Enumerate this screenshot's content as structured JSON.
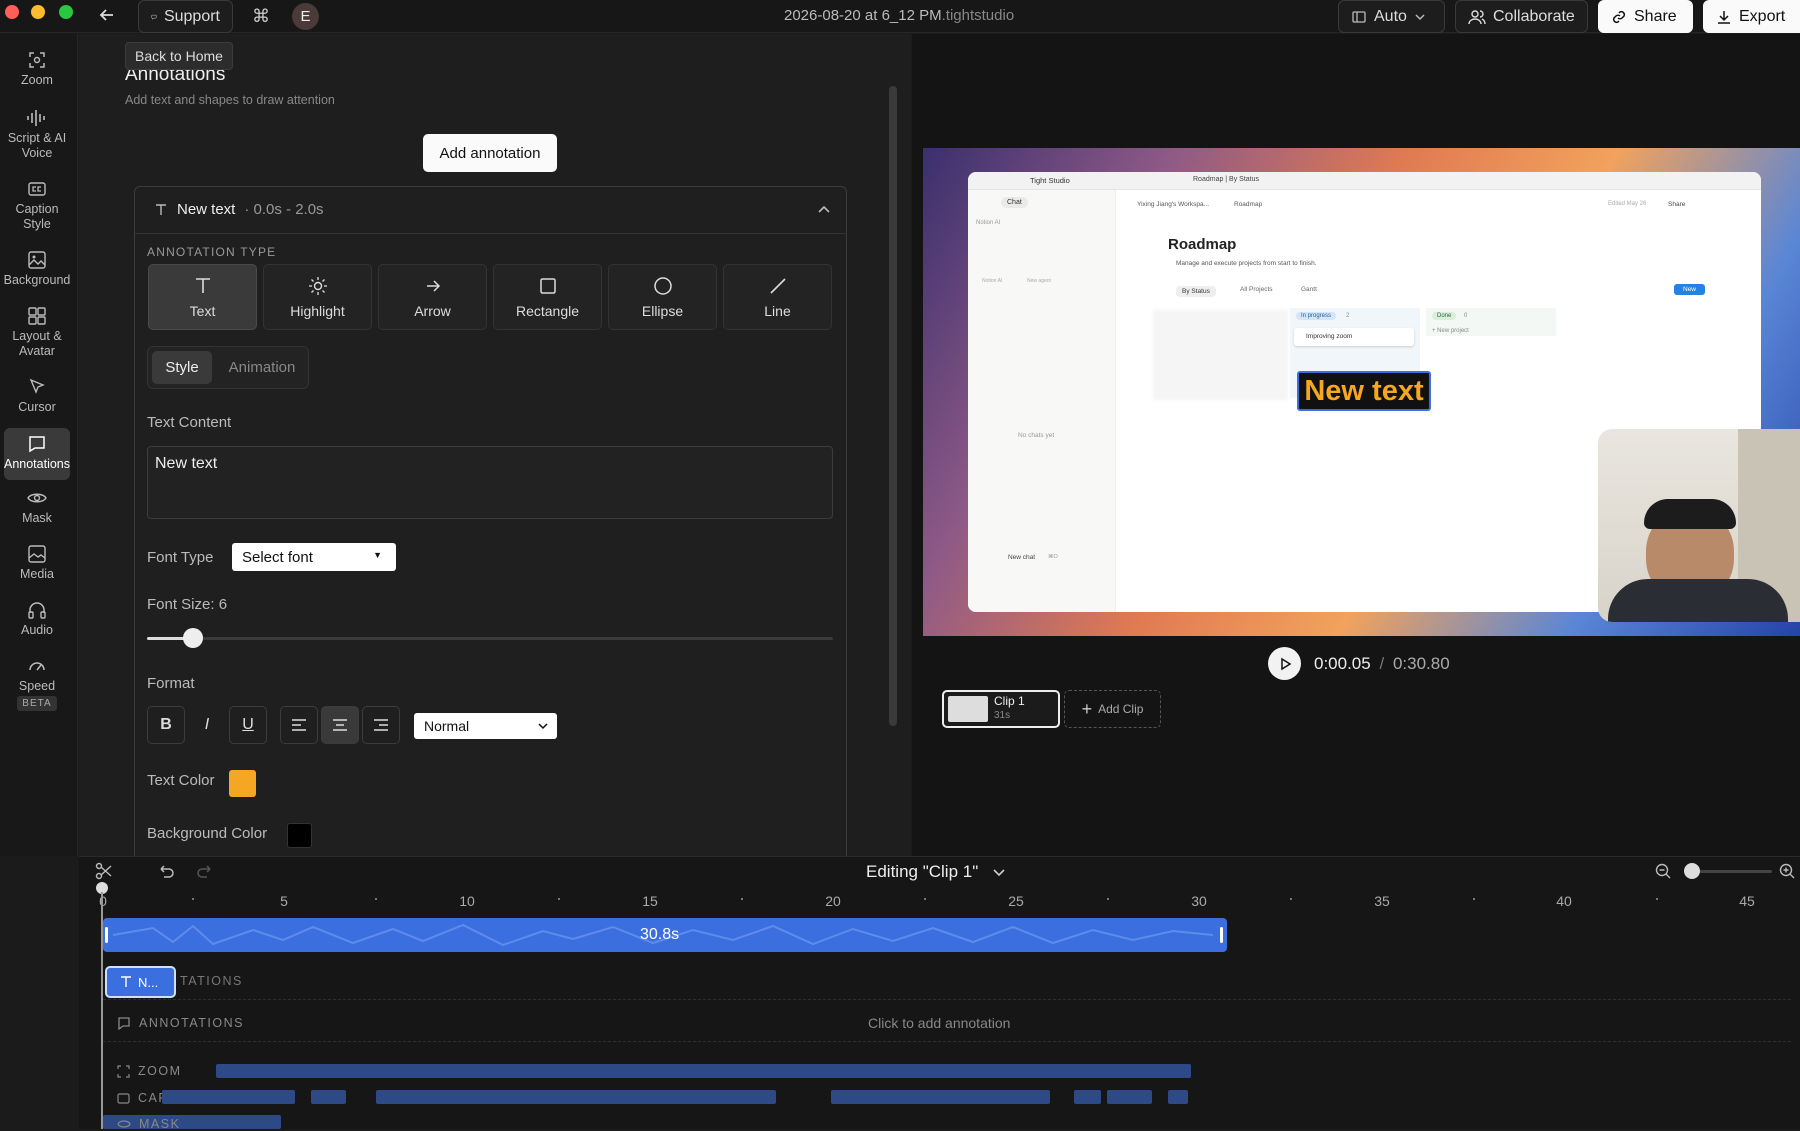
{
  "window": {
    "title_main": "2026-08-20 at 6_12 PM",
    "title_ext": ".tightstudio",
    "avatar_letter": "E"
  },
  "toolbar": {
    "support": "Support",
    "auto": "Auto",
    "collaborate": "Collaborate",
    "share": "Share",
    "export": "Export"
  },
  "tooltip": "Back to Home",
  "rail": [
    {
      "label": "Zoom",
      "icon": "zoom-icon"
    },
    {
      "label": "Script & AI Voice",
      "icon": "waveform-icon"
    },
    {
      "label": "Caption Style",
      "icon": "caption-icon"
    },
    {
      "label": "Background",
      "icon": "image-icon"
    },
    {
      "label": "Layout & Avatar",
      "icon": "grid-icon"
    },
    {
      "label": "Cursor",
      "icon": "cursor-icon"
    },
    {
      "label": "Annotations",
      "icon": "annotation-icon"
    },
    {
      "label": "Mask",
      "icon": "eye-icon"
    },
    {
      "label": "Media",
      "icon": "media-icon"
    },
    {
      "label": "Audio",
      "icon": "headphones-icon"
    },
    {
      "label": "Speed",
      "icon": "speedometer-icon",
      "badge": "BETA"
    }
  ],
  "panel": {
    "title": "Annotations",
    "subtitle": "Add text and shapes to draw attention",
    "add_button": "Add annotation",
    "item": {
      "name": "New text",
      "range": "· 0.0s - 2.0s"
    },
    "type_label": "ANNOTATION TYPE",
    "types": [
      "Text",
      "Highlight",
      "Arrow",
      "Rectangle",
      "Ellipse",
      "Line"
    ],
    "tabs": [
      "Style",
      "Animation"
    ],
    "text_content_label": "Text Content",
    "text_content": "New text",
    "font_type_label": "Font Type",
    "font_select": "Select font",
    "font_size_label": "Font Size: 6",
    "font_size_value": 6,
    "format_label": "Format",
    "format_buttons": [
      "B",
      "I",
      "U"
    ],
    "weight_select": "Normal",
    "text_color_label": "Text Color",
    "text_color": "#f5a623",
    "bg_color_label": "Background Color",
    "bg_color": "#000000"
  },
  "preview": {
    "overlay_text": "New text",
    "app": {
      "brand": "Tight Studio",
      "tab": "Roadmap | By Status",
      "breadcrumb1": "Yixing Jiang's Workspa...",
      "breadcrumb2": "Roadmap",
      "edited": "Edited May 26",
      "share": "Share",
      "chat": "Chat",
      "notion_ai": "Notion AI",
      "new_agent": "New agent",
      "notion_ai_small": "Notion AI",
      "no_chats": "No chats yet",
      "new_chat": "New chat",
      "new_chat_kbd": "⌘O",
      "heading": "Roadmap",
      "desc": "Manage and execute projects from start to finish.",
      "views": [
        "By Status",
        "All Projects",
        "Gantt"
      ],
      "new_btn": "New",
      "cols": [
        {
          "name": "In progress",
          "count": "2"
        },
        {
          "name": "Done",
          "count": "0"
        }
      ],
      "card1": "Improving zoom",
      "new_project": "+ New project"
    },
    "time_current": "0:00.05",
    "time_sep": "/",
    "time_total": "0:30.80",
    "clip": {
      "name": "Clip 1",
      "dur": "31s"
    },
    "add_clip": "Add Clip"
  },
  "timeline": {
    "editing": "Editing \"Clip 1\"",
    "ticks": [
      "0",
      "5",
      "10",
      "15",
      "20",
      "25",
      "30",
      "35",
      "40",
      "45"
    ],
    "clip_duration": "30.8s",
    "annotation_chip": "N...",
    "annotation_track_label": "ANNOTATIONS",
    "annotation_ghost_label": "TATIONS",
    "click_to_add": "Click to add annotation",
    "tracks": [
      "ZOOM",
      "CAPTION",
      "MASK"
    ]
  },
  "colors": {
    "accent": "#3b6fe0",
    "overlay_text": "#f5a623",
    "text_color_swatch": "#f5a623"
  }
}
